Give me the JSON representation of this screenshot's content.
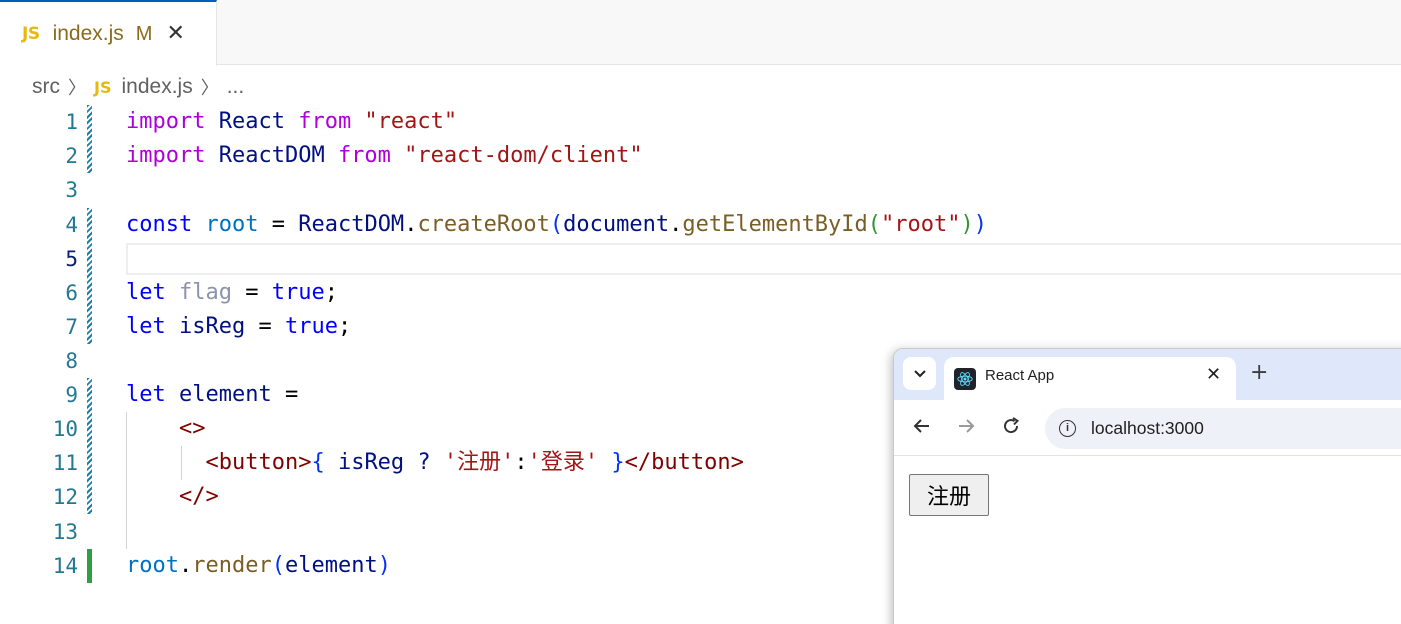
{
  "editor": {
    "tab": {
      "icon": "JS",
      "filename": "index.js",
      "status": "M",
      "close": "✕"
    },
    "breadcrumb": {
      "folder": "src",
      "file_icon": "JS",
      "file": "index.js",
      "more": "..."
    },
    "lines": [
      {
        "number": "1"
      },
      {
        "number": "2"
      },
      {
        "number": "3"
      },
      {
        "number": "4"
      },
      {
        "number": "5"
      },
      {
        "number": "6"
      },
      {
        "number": "7"
      },
      {
        "number": "8"
      },
      {
        "number": "9"
      },
      {
        "number": "10"
      },
      {
        "number": "11"
      },
      {
        "number": "12"
      },
      {
        "number": "13"
      },
      {
        "number": "14"
      }
    ],
    "code": {
      "l1": {
        "kw1": "import",
        "name": " React ",
        "kw2": "from",
        "str": " \"react\""
      },
      "l2": {
        "kw1": "import",
        "name": " ReactDOM ",
        "kw2": "from",
        "str": " \"react-dom/client\""
      },
      "l4": {
        "decl": "const",
        "root": " root",
        "eq": " = ",
        "obj": "ReactDOM",
        "dot1": ".",
        "fn1": "createRoot",
        "p1": "(",
        "doc": "document",
        "dot2": ".",
        "fn2": "getElementById",
        "p2": "(",
        "str": "\"root\"",
        "p3": ")",
        "p4": ")"
      },
      "l6": {
        "decl": "let",
        "name": " flag",
        "eq": " = ",
        "val": "true",
        "semi": ";"
      },
      "l7": {
        "decl": "let",
        "name": " isReg",
        "eq": " = ",
        "val": "true",
        "semi": ";"
      },
      "l9": {
        "decl": "let",
        "name": " element",
        "eq": " ="
      },
      "l10": {
        "tag": "<>"
      },
      "l11": {
        "open": "<button>",
        "b1": "{",
        "expr": " isReg ? ",
        "s1": "'注册'",
        "colon": ":",
        "s2": "'登录'",
        "sp": " ",
        "b2": "}",
        "close": "</button>"
      },
      "l12": {
        "tag": "</>"
      },
      "l14": {
        "root": "root",
        "dot": ".",
        "fn": "render",
        "p1": "(",
        "arg": "element",
        "p2": ")"
      }
    }
  },
  "browser": {
    "tab_title": "React App",
    "tab_close": "✕",
    "new_tab": "+",
    "url": "localhost:3000",
    "page_button": "注册"
  },
  "colors": {
    "keyword_control": "#af00db",
    "keyword_decl": "#0000ff",
    "string": "#a31515",
    "variable": "#001080",
    "constant": "#0070c1",
    "function": "#795e26",
    "jsx_tag": "#800000",
    "line_number": "#237893",
    "tab_accent": "#005fb8",
    "js_icon": "#e8b90d",
    "git_modified": "#1b81a8",
    "git_added": "#2ea043"
  },
  "icons": [
    "js-file-icon",
    "close-icon",
    "chevron-right-icon",
    "chevron-down-icon",
    "react-logo-icon",
    "plus-icon",
    "back-arrow-icon",
    "forward-arrow-icon",
    "reload-icon",
    "info-icon"
  ]
}
